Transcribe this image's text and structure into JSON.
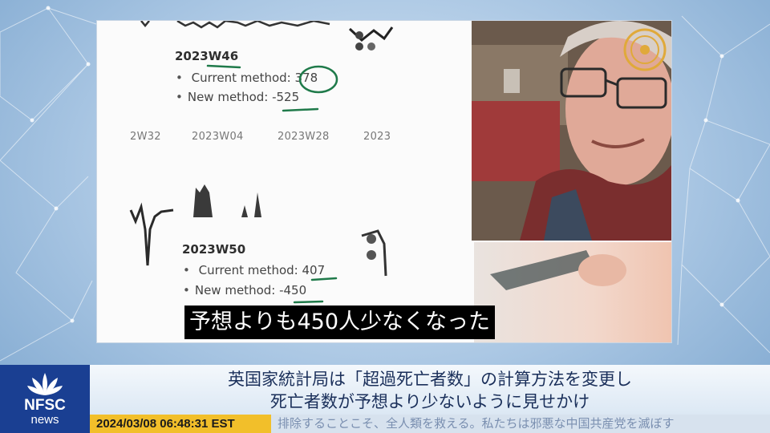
{
  "doc": {
    "top_block": {
      "week": "2023W46",
      "current_label": "Current method: ",
      "current_value": "378",
      "new_label": "New method: -525"
    },
    "axis_ticks": [
      "2W32",
      "2023W04",
      "2023W28",
      "2023"
    ],
    "bottom_block": {
      "week": "2023W50",
      "current_label": "Current method: ",
      "current_value": "407",
      "new_label": "New method: -450"
    }
  },
  "subtitle": "予想よりも450人少なくなった",
  "headline": {
    "line1": "英国家統計局は「超過死亡者数」の計算方法を変更し",
    "line2": "死亡者数が予想より少ないように見せかけ"
  },
  "brand": {
    "name": "NFSC",
    "tag": "news"
  },
  "ticker": {
    "timestamp": "2024/03/08 06:48:31 EST",
    "scroll_text": "排除することこそ、全人類を救える。私たちは邪悪な中国共産党を滅ぼす"
  },
  "colors": {
    "logo_bg": "#1a3f92",
    "timestamp_bg": "#f2bf2a",
    "annotation_green": "#1f7a4a"
  }
}
